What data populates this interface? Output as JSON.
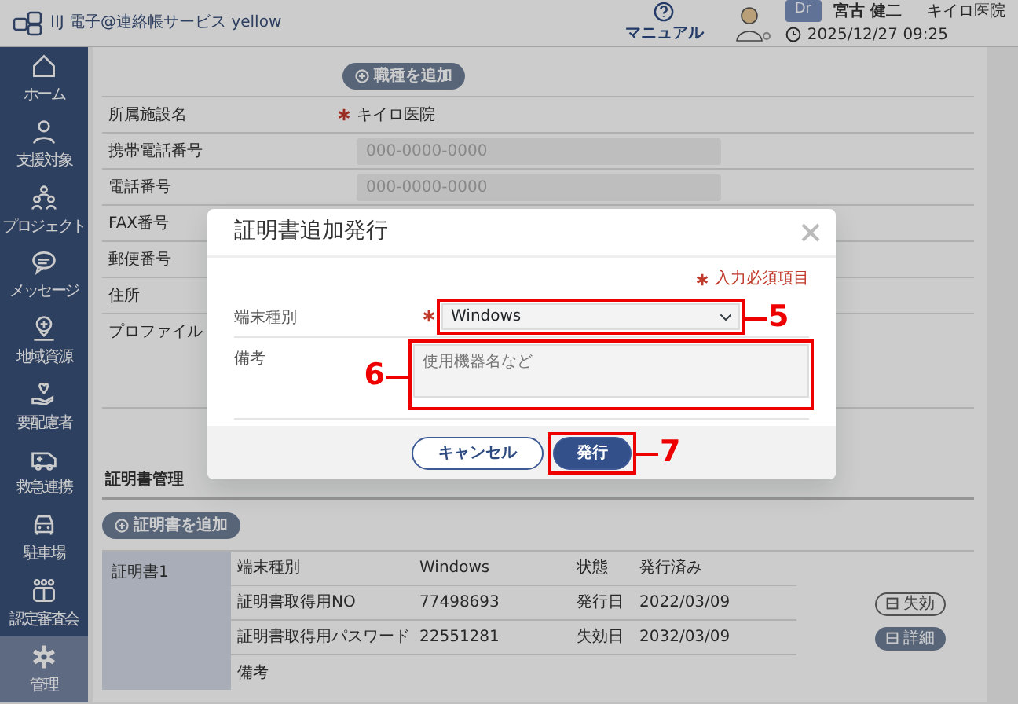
{
  "header": {
    "logo_text": "IIJ 電子@連絡帳サービス yellow",
    "help_label": "マニュアル",
    "role_badge": "Dr",
    "user_name": "宮古 健二",
    "facility": "キイロ医院",
    "datetime": "2025/12/27 09:25"
  },
  "sidebar": {
    "items": [
      {
        "label": "ホーム",
        "selected": false
      },
      {
        "label": "支援対象",
        "selected": false
      },
      {
        "label": "プロジェクト",
        "selected": false
      },
      {
        "label": "メッセージ",
        "selected": false
      },
      {
        "label": "地域資源",
        "selected": false
      },
      {
        "label": "要配慮者",
        "selected": false
      },
      {
        "label": "救急連携",
        "selected": false
      },
      {
        "label": "駐車場",
        "selected": false
      },
      {
        "label": "認定審査会",
        "selected": false
      },
      {
        "label": "管理",
        "selected": true
      }
    ]
  },
  "profile_form": {
    "add_job_button": "職種を追加",
    "rows": [
      {
        "label": "所属施設名",
        "required": true,
        "kind": "text",
        "value": "キイロ医院"
      },
      {
        "label": "携帯電話番号",
        "required": false,
        "kind": "input",
        "placeholder": "000-0000-0000"
      },
      {
        "label": "電話番号",
        "required": false,
        "kind": "input",
        "placeholder": "000-0000-0000"
      },
      {
        "label": "FAX番号",
        "required": false
      },
      {
        "label": "郵便番号",
        "required": false
      },
      {
        "label": "住所",
        "required": false
      },
      {
        "label": "プロファイル",
        "required": false,
        "kind": "tall"
      }
    ]
  },
  "certificates": {
    "title": "証明書管理",
    "add_button": "証明書を追加",
    "items": [
      {
        "name": "証明書1",
        "rows": [
          {
            "label": "端末種別",
            "value": "Windows",
            "label2": "状態",
            "value2": "発行済み"
          },
          {
            "label": "証明書取得用NO",
            "value": "77498693",
            "label2": "発行日",
            "value2": "2022/03/09",
            "action": {
              "label": "失効",
              "kind": "outline"
            }
          },
          {
            "label": "証明書取得用パスワード",
            "value": "22551281",
            "label2": "失効日",
            "value2": "2032/03/09",
            "action": {
              "label": "詳細",
              "kind": "filled"
            }
          },
          {
            "label": "備考"
          }
        ]
      }
    ]
  },
  "dialog": {
    "title": "証明書追加発行",
    "required_note": "入力必須項目",
    "fields": [
      {
        "label": "端末種別",
        "required": true,
        "kind": "select",
        "value": "Windows",
        "callout": {
          "number": "5"
        }
      },
      {
        "label": "備考",
        "required": false,
        "kind": "textarea",
        "placeholder": "使用機器名など",
        "callout": {
          "number": "6"
        }
      }
    ],
    "buttons": [
      {
        "label": "キャンセル",
        "kind": "secondary"
      },
      {
        "label": "発行",
        "kind": "primary",
        "callout": {
          "number": "7"
        }
      }
    ]
  }
}
